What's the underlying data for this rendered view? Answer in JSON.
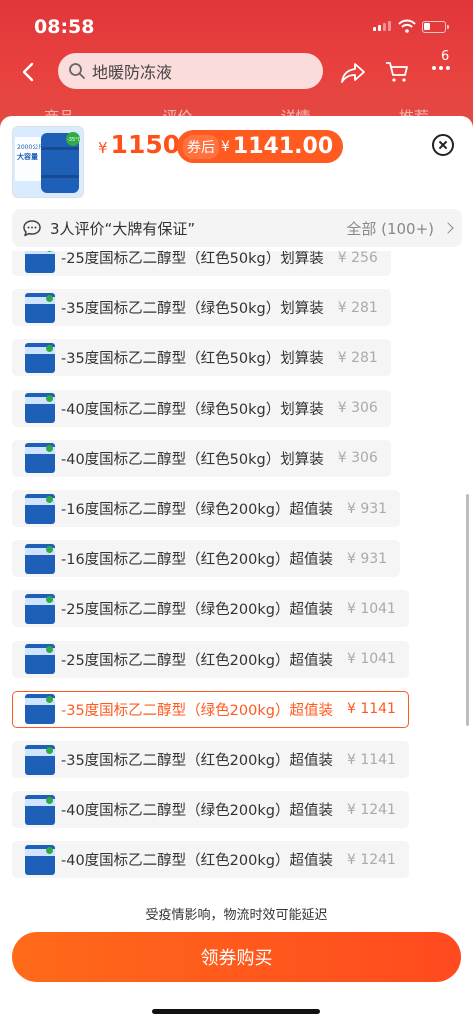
{
  "status_bar": {
    "time": "08:58"
  },
  "header": {
    "search_text": "地暖防冻液",
    "cart_badge": "6",
    "faint_tabs": [
      "商品",
      "评价",
      "详情",
      "推荐"
    ]
  },
  "sheet": {
    "price_currency": "¥",
    "price": "1150",
    "coupon_label": "券后",
    "coupon_currency": "¥",
    "coupon_price": "1141.00",
    "reviews_text": "3人评价“大牌有保证”",
    "reviews_all": "全部 (100+)",
    "thumb_text": [
      "2000公斤",
      "大容量",
      "-35°C"
    ]
  },
  "options": [
    {
      "name": "-25度国标乙二醇型（红色50kg）划算装",
      "price": "¥ 256",
      "selected": false
    },
    {
      "name": "-35度国标乙二醇型（绿色50kg）划算装",
      "price": "¥ 281",
      "selected": false
    },
    {
      "name": "-35度国标乙二醇型（红色50kg）划算装",
      "price": "¥ 281",
      "selected": false
    },
    {
      "name": "-40度国标乙二醇型（绿色50kg）划算装",
      "price": "¥ 306",
      "selected": false
    },
    {
      "name": "-40度国标乙二醇型（红色50kg）划算装",
      "price": "¥ 306",
      "selected": false
    },
    {
      "name": "-16度国标乙二醇型（绿色200kg）超值装",
      "price": "¥ 931",
      "selected": false
    },
    {
      "name": "-16度国标乙二醇型（红色200kg）超值装",
      "price": "¥ 931",
      "selected": false
    },
    {
      "name": "-25度国标乙二醇型（绿色200kg）超值装",
      "price": "¥ 1041",
      "selected": false
    },
    {
      "name": "-25度国标乙二醇型（红色200kg）超值装",
      "price": "¥ 1041",
      "selected": false
    },
    {
      "name": "-35度国标乙二醇型（绿色200kg）超值装",
      "price": "¥ 1141",
      "selected": true
    },
    {
      "name": "-35度国标乙二醇型（红色200kg）超值装",
      "price": "¥ 1141",
      "selected": false
    },
    {
      "name": "-40度国标乙二醇型（绿色200kg）超值装",
      "price": "¥ 1241",
      "selected": false
    },
    {
      "name": "-40度国标乙二醇型（红色200kg）超值装",
      "price": "¥ 1241",
      "selected": false
    }
  ],
  "footer": {
    "notice": "受疫情影响，物流时效可能延迟",
    "buy_label": "领券购买"
  },
  "colors": {
    "accent": "#ff5a1f",
    "header_red": "#e2363a"
  }
}
